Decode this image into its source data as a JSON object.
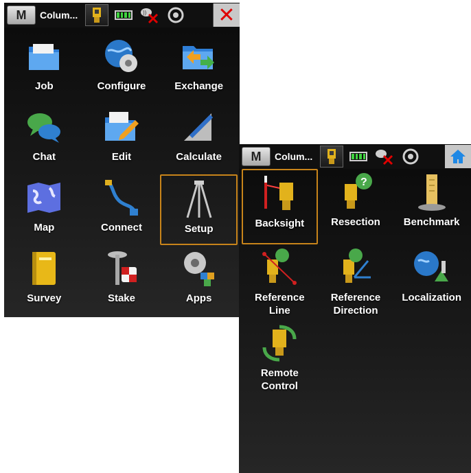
{
  "screen1": {
    "status": {
      "mode_letter": "M",
      "title": "Colum...",
      "close_symbol": "✕"
    },
    "apps": [
      {
        "label": "Job",
        "icon": "folder-icon"
      },
      {
        "label": "Configure",
        "icon": "globe-gear-icon"
      },
      {
        "label": "Exchange",
        "icon": "folder-exchange-icon"
      },
      {
        "label": "Chat",
        "icon": "chat-bubbles-icon"
      },
      {
        "label": "Edit",
        "icon": "folder-pencil-icon"
      },
      {
        "label": "Calculate",
        "icon": "ruler-pencil-icon"
      },
      {
        "label": "Map",
        "icon": "world-map-icon"
      },
      {
        "label": "Connect",
        "icon": "cable-icon"
      },
      {
        "label": "Setup",
        "icon": "tripod-icon",
        "selected": true
      },
      {
        "label": "Survey",
        "icon": "notebook-icon"
      },
      {
        "label": "Stake",
        "icon": "stake-icon"
      },
      {
        "label": "Apps",
        "icon": "gear-apps-icon"
      }
    ]
  },
  "screen2": {
    "status": {
      "mode_letter": "M",
      "title": "Colum..."
    },
    "apps": [
      {
        "label": "Backsight",
        "icon": "backsight-icon",
        "selected": true
      },
      {
        "label": "Resection",
        "icon": "resection-icon"
      },
      {
        "label": "Benchmark",
        "icon": "benchmark-icon"
      },
      {
        "label": "Reference\nLine",
        "icon": "reference-line-icon"
      },
      {
        "label": "Reference\nDirection",
        "icon": "reference-direction-icon"
      },
      {
        "label": "Localization",
        "icon": "localization-icon"
      },
      {
        "label": "Remote\nControl",
        "icon": "remote-control-icon"
      }
    ]
  },
  "colors": {
    "selection": "#c8841a",
    "battery": "#3fd33f",
    "close": "#e00000",
    "home": "#1e88e5"
  }
}
